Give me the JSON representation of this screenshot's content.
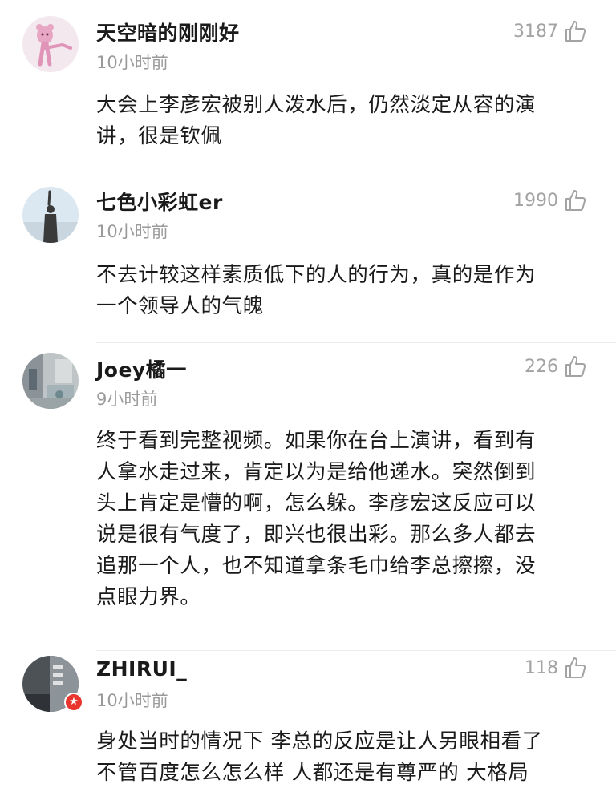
{
  "comments": [
    {
      "username": "天空暗的刚刚好",
      "time": "10小时前",
      "likes": "3187",
      "text": "大会上李彦宏被别人泼水后，仍然淡定从容的演\n讲，很是钦佩",
      "avatar": "pink-panther-avatar"
    },
    {
      "username": "七色小彩虹er",
      "time": "10小时前",
      "likes": "1990",
      "text": "不去计较这样素质低下的人的行为，真的是作为\n一个领导人的气魄",
      "avatar": "person-sky-avatar"
    },
    {
      "username": "Joey橘一",
      "time": "9小时前",
      "likes": "226",
      "text": "终于看到完整视频。如果你在台上演讲，看到有\n人拿水走过来，肯定以为是给他递水。突然倒到\n头上肯定是懵的啊，怎么躲。李彦宏这反应可以\n说是很有气度了，即兴也很出彩。那么多人都去\n追那一个人，也不知道拿条毛巾给李总擦擦，没\n点眼力界。",
      "avatar": "street-photo-avatar"
    },
    {
      "username": "ZHIRUI_",
      "time": "10小时前",
      "likes": "118",
      "text": "身处当时的情况下 李总的反应是让人另眼相看了\n不管百度怎么怎么样 人都还是有尊严的 大格局",
      "avatar": "dark-photo-avatar",
      "badge": "verified-badge-icon"
    }
  ],
  "icons": {
    "like": "thumbs-up-icon"
  },
  "colors": {
    "username": "#1a1a1a",
    "meta": "#9a9a9a",
    "badge": "#e8352e"
  }
}
